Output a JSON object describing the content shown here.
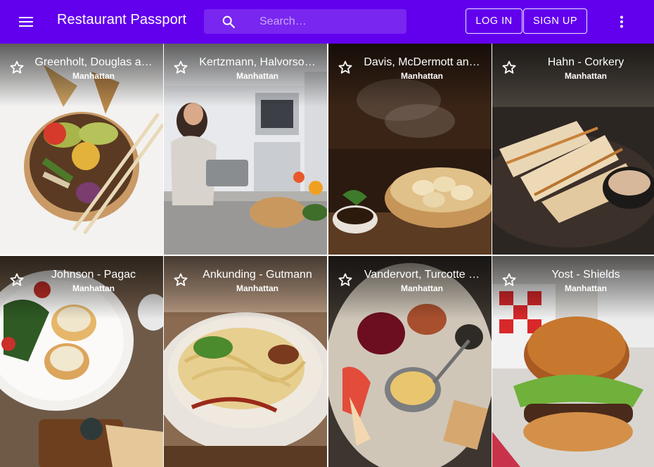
{
  "app": {
    "title": "Restaurant Passport",
    "brand_color": "#6200ee"
  },
  "toolbar": {
    "menu_icon": "hamburger-menu-icon",
    "search_icon": "search-icon",
    "search_placeholder": "Search…",
    "login_label": "LOG IN",
    "signup_label": "SIGN UP",
    "more_icon": "more-vert-icon"
  },
  "restaurants": [
    {
      "name": "Greenholt, Douglas a…",
      "location": "Manhattan",
      "photo": "poke-bowl-icon"
    },
    {
      "name": "Kertzmann, Halvorso…",
      "location": "Manhattan",
      "photo": "kitchen-cook-icon"
    },
    {
      "name": "Davis, McDermott an…",
      "location": "Manhattan",
      "photo": "dumplings-icon"
    },
    {
      "name": "Hahn - Corkery",
      "location": "Manhattan",
      "photo": "grilled-seafood-icon"
    },
    {
      "name": "Johnson - Pagac",
      "location": "Manhattan",
      "photo": "eggs-benedict-icon"
    },
    {
      "name": "Ankunding - Gutmann",
      "location": "Manhattan",
      "photo": "pasta-icon"
    },
    {
      "name": "Vandervort, Turcotte …",
      "location": "Manhattan",
      "photo": "charcuterie-board-icon"
    },
    {
      "name": "Yost - Shields",
      "location": "Manhattan",
      "photo": "burger-icon"
    }
  ]
}
